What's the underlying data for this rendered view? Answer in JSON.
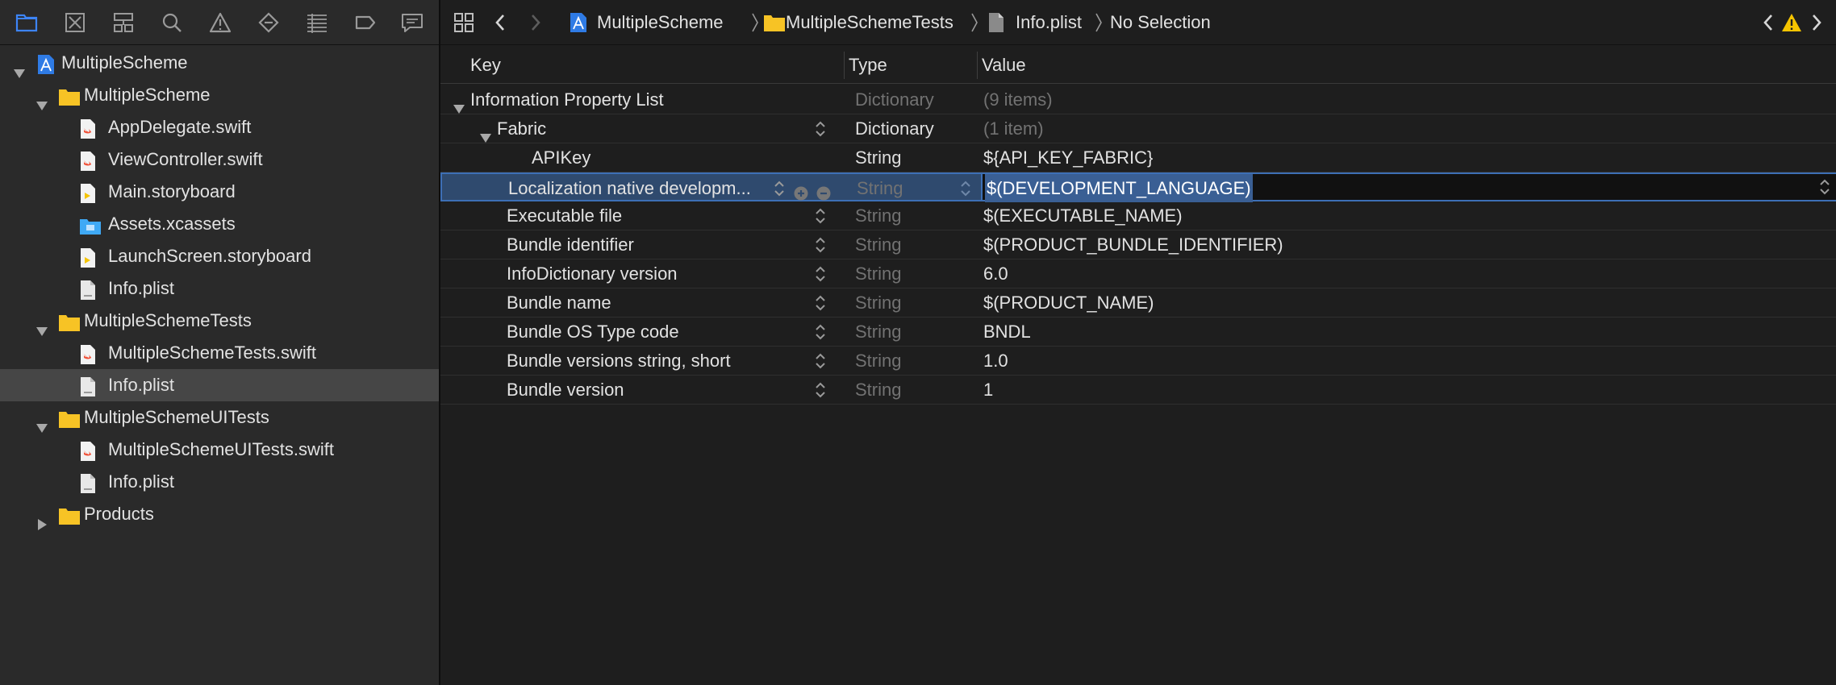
{
  "navigator": {
    "toolbar": [
      {
        "name": "project-navigator-icon",
        "active": true
      },
      {
        "name": "source-control-icon"
      },
      {
        "name": "symbol-navigator-icon"
      },
      {
        "name": "find-icon"
      },
      {
        "name": "issue-warning-icon"
      },
      {
        "name": "test-diamond-icon"
      },
      {
        "name": "debug-list-icon"
      },
      {
        "name": "breakpoint-tag-icon"
      },
      {
        "name": "report-bubble-icon"
      }
    ],
    "tree": [
      {
        "label": "MultipleScheme",
        "kind": "project",
        "depth": 0,
        "expanded": true
      },
      {
        "label": "MultipleScheme",
        "kind": "folder",
        "depth": 1,
        "expanded": true
      },
      {
        "label": "AppDelegate.swift",
        "kind": "swift",
        "depth": 2
      },
      {
        "label": "ViewController.swift",
        "kind": "swift",
        "depth": 2
      },
      {
        "label": "Main.storyboard",
        "kind": "storyboard",
        "depth": 2
      },
      {
        "label": "Assets.xcassets",
        "kind": "assets",
        "depth": 2
      },
      {
        "label": "LaunchScreen.storyboard",
        "kind": "storyboard",
        "depth": 2
      },
      {
        "label": "Info.plist",
        "kind": "plist",
        "depth": 2
      },
      {
        "label": "MultipleSchemeTests",
        "kind": "folder",
        "depth": 1,
        "expanded": true
      },
      {
        "label": "MultipleSchemeTests.swift",
        "kind": "swift",
        "depth": 2
      },
      {
        "label": "Info.plist",
        "kind": "plist",
        "depth": 2,
        "selected": true
      },
      {
        "label": "MultipleSchemeUITests",
        "kind": "folder",
        "depth": 1,
        "expanded": true
      },
      {
        "label": "MultipleSchemeUITests.swift",
        "kind": "swift",
        "depth": 2
      },
      {
        "label": "Info.plist",
        "kind": "plist",
        "depth": 2
      },
      {
        "label": "Products",
        "kind": "folder",
        "depth": 1,
        "expanded": false
      }
    ]
  },
  "jump_bar": {
    "project": "MultipleScheme",
    "group": "MultipleSchemeTests",
    "file": "Info.plist",
    "selection": "No Selection"
  },
  "plist": {
    "headers": {
      "key": "Key",
      "type": "Type",
      "value": "Value"
    },
    "rows": [
      {
        "key": "Information Property List",
        "type": "Dictionary",
        "value": "(9 items)",
        "depth": 0,
        "disclosure": true,
        "type_muted": true,
        "value_muted": true
      },
      {
        "key": "Fabric",
        "type": "Dictionary",
        "value": "(1 item)",
        "depth": 1,
        "disclosure": true,
        "stepper": true,
        "value_muted": true
      },
      {
        "key": "APIKey",
        "type": "String",
        "value": "${API_KEY_FABRIC}",
        "depth": 2
      },
      {
        "key": "Localization native developm...",
        "type": "String",
        "value": "$(DEVELOPMENT_LANGUAGE)",
        "depth": 1,
        "stepper": true,
        "type_muted": true,
        "selected": true
      },
      {
        "key": "Executable file",
        "type": "String",
        "value": "$(EXECUTABLE_NAME)",
        "depth": 1,
        "stepper": true,
        "type_muted": true
      },
      {
        "key": "Bundle identifier",
        "type": "String",
        "value": "$(PRODUCT_BUNDLE_IDENTIFIER)",
        "depth": 1,
        "stepper": true,
        "type_muted": true
      },
      {
        "key": "InfoDictionary version",
        "type": "String",
        "value": "6.0",
        "depth": 1,
        "stepper": true,
        "type_muted": true
      },
      {
        "key": "Bundle name",
        "type": "String",
        "value": "$(PRODUCT_NAME)",
        "depth": 1,
        "stepper": true,
        "type_muted": true
      },
      {
        "key": "Bundle OS Type code",
        "type": "String",
        "value": "BNDL",
        "depth": 1,
        "stepper": true,
        "type_muted": true
      },
      {
        "key": "Bundle versions string, short",
        "type": "String",
        "value": "1.0",
        "depth": 1,
        "stepper": true,
        "type_muted": true
      },
      {
        "key": "Bundle version",
        "type": "String",
        "value": "1",
        "depth": 1,
        "stepper": true,
        "type_muted": true
      }
    ]
  },
  "colors": {
    "accent": "#3d84f7",
    "folder": "#f7c325",
    "swift": "#f05138",
    "warning": "#f5c400"
  }
}
